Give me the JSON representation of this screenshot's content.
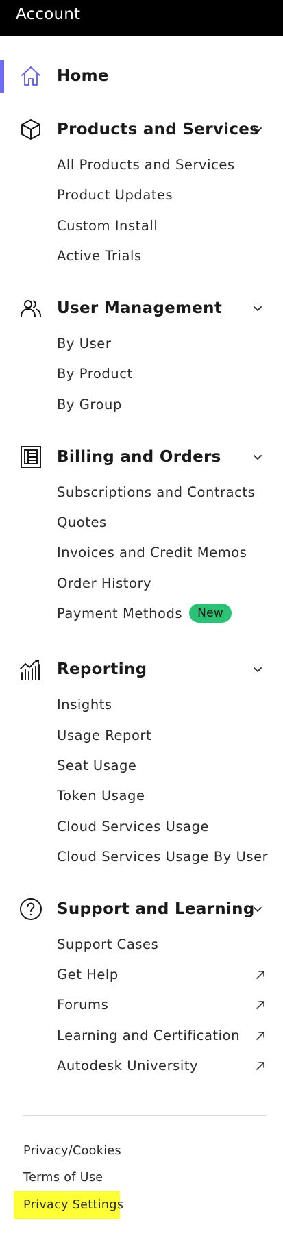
{
  "header": {
    "title": "Account"
  },
  "accent_color": "#6f6af8",
  "badge_color": "#2bc275",
  "highlight_color": "#ffff36",
  "nav": {
    "home": {
      "label": "Home",
      "icon": "home-icon"
    },
    "products": {
      "label": "Products and Services",
      "icon": "cube-icon",
      "items": [
        "All Products and Services",
        "Product Updates",
        "Custom Install",
        "Active Trials"
      ]
    },
    "users": {
      "label": "User Management",
      "icon": "users-icon",
      "items": [
        "By User",
        "By Product",
        "By Group"
      ]
    },
    "billing": {
      "label": "Billing and Orders",
      "icon": "receipt-icon",
      "items": [
        "Subscriptions and Contracts",
        "Quotes",
        "Invoices and Credit Memos",
        "Order History",
        "Payment Methods"
      ],
      "badge": "New"
    },
    "reporting": {
      "label": "Reporting",
      "icon": "chart-icon",
      "items": [
        "Insights",
        "Usage Report",
        "Seat Usage",
        "Token Usage",
        "Cloud Services Usage",
        "Cloud Services Usage By User"
      ]
    },
    "support": {
      "label": "Support and Learning",
      "icon": "question-icon",
      "items": [
        "Support Cases",
        "Get Help",
        "Forums",
        "Learning and Certification",
        "Autodesk University"
      ]
    }
  },
  "footer": {
    "links": [
      "Privacy/Cookies",
      "Terms of Use",
      "Privacy Settings"
    ]
  }
}
